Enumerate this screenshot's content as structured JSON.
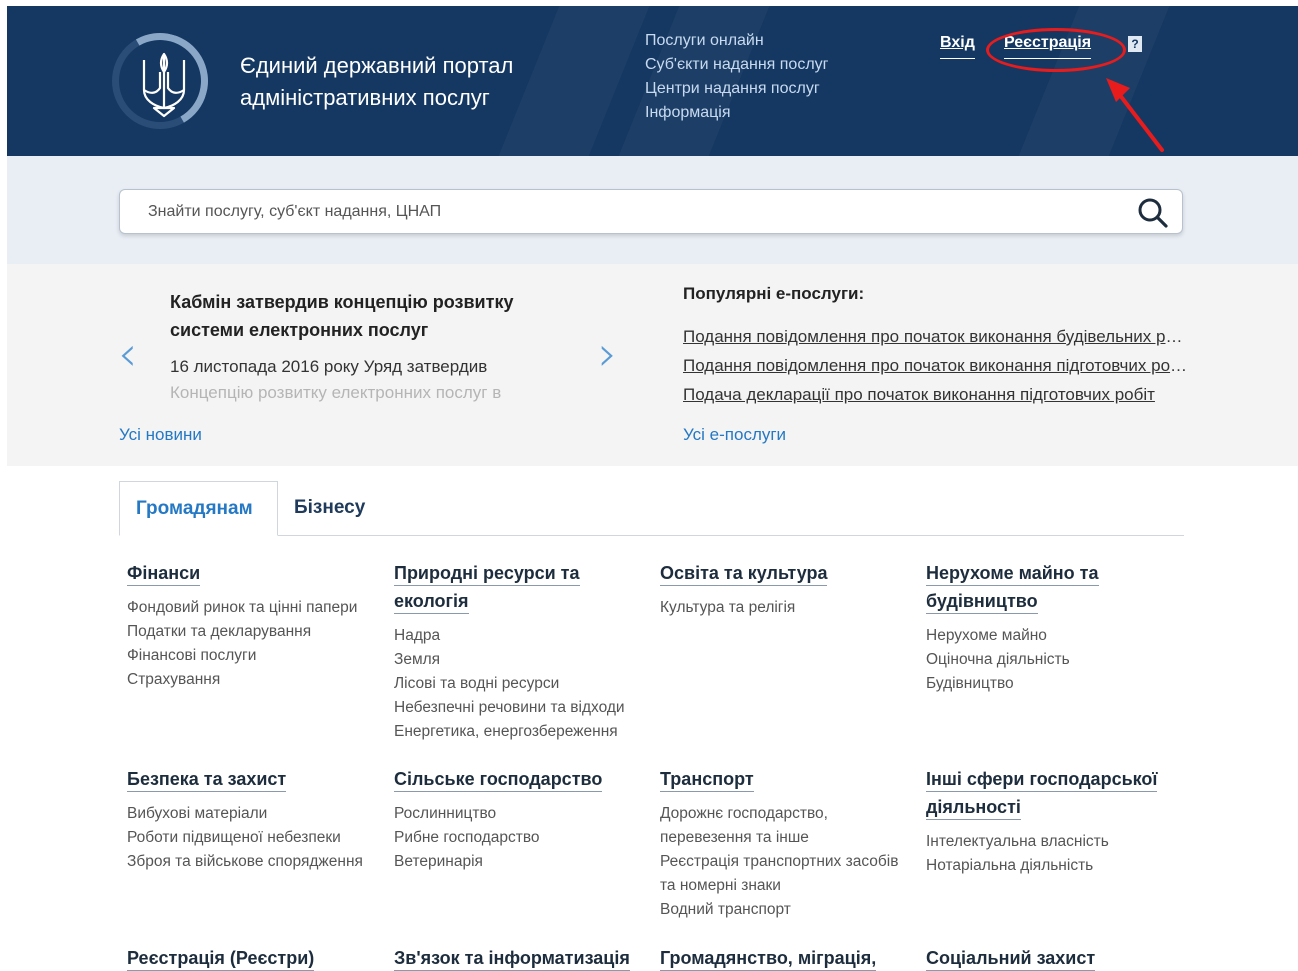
{
  "header": {
    "title_line1": "Єдиний державний портал",
    "title_line2": "адміністративних послуг",
    "nav": [
      "Послуги онлайн",
      "Суб'єкти надання послуг",
      "Центри надання послуг",
      "Інформація"
    ],
    "login": "Вхід",
    "register": "Реєстрація",
    "help": "?"
  },
  "search": {
    "placeholder": "Знайти послугу, суб'єкт надання, ЦНАП"
  },
  "news": {
    "title": "Кабмін затвердив концепцію розвитку системи електронних послуг",
    "text_line1": "16 листопада 2016 року Уряд затвердив",
    "text_line2": "Концепцію розвитку електронних послуг в",
    "prev": "‹",
    "next": "›",
    "all_link": "Усі новини"
  },
  "popular": {
    "heading": "Популярні е-послуги:",
    "items": [
      "Подання повідомлення про початок виконання будівельних робіт",
      "Подання повідомлення про початок виконання підготовчих робіт",
      "Подача декларації про початок виконання підготовчих робіт"
    ],
    "all_link": "Усі е-послуги"
  },
  "tabs": {
    "citizens": "Громадянам",
    "business": "Бізнесу"
  },
  "categories": [
    {
      "title": "Фінанси",
      "items": [
        "Фондовий ринок та цінні папери",
        "Податки та декларування",
        "Фінансові послуги",
        "Страхування"
      ]
    },
    {
      "title": "Природні ресурси та екологія",
      "items": [
        "Надра",
        "Земля",
        "Лісові та водні ресурси",
        "Небезпечні речовини та відходи",
        "Енергетика, енергозбереження"
      ]
    },
    {
      "title": "Освіта та культура",
      "items": [
        "Культура та релігія"
      ]
    },
    {
      "title": "Нерухоме майно та будівництво",
      "items": [
        "Нерухоме майно",
        "Оціночна діяльність",
        "Будівництво"
      ]
    },
    {
      "title": "Безпека та захист",
      "items": [
        "Вибухові матеріали",
        "Роботи підвищеної небезпеки",
        "Зброя та військове спорядження"
      ]
    },
    {
      "title": "Сільське господарство",
      "items": [
        "Рослинництво",
        "Рибне господарство",
        "Ветеринарія"
      ]
    },
    {
      "title": "Транспорт",
      "items": [
        "Дорожнє господарство, перевезення та інше",
        "Реєстрація транспортних засобів та номерні знаки",
        "Водний транспорт"
      ]
    },
    {
      "title": "Інші сфери господарської діяльності",
      "items": [
        "Інтелектуальна власність",
        "Нотаріальна діяльність"
      ]
    },
    {
      "title": "Реєстрація (Реєстри)",
      "items": []
    },
    {
      "title": "Зв'язок та інформатизація",
      "items": []
    },
    {
      "title": "Громадянство, міграція,",
      "items": []
    },
    {
      "title": "Соціальний захист",
      "items": []
    }
  ],
  "colors": {
    "header_bg": "#153862",
    "link_blue": "#2478c4",
    "annotation_red": "#e81c1c"
  }
}
